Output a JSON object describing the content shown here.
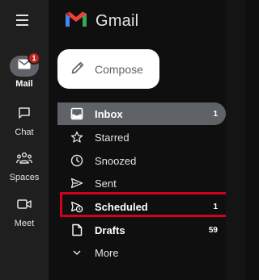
{
  "rail": {
    "items": [
      {
        "label": "Mail",
        "icon": "mail-icon",
        "badge": "1",
        "active": true
      },
      {
        "label": "Chat",
        "icon": "chat-icon"
      },
      {
        "label": "Spaces",
        "icon": "spaces-icon"
      },
      {
        "label": "Meet",
        "icon": "meet-icon"
      }
    ]
  },
  "brand": {
    "name": "Gmail",
    "icon": "gmail-logo"
  },
  "compose": {
    "label": "Compose",
    "icon": "pencil-icon"
  },
  "nav": {
    "items": [
      {
        "label": "Inbox",
        "count": "1",
        "icon": "inbox-icon",
        "active": true
      },
      {
        "label": "Starred",
        "count": "",
        "icon": "star-icon"
      },
      {
        "label": "Snoozed",
        "count": "",
        "icon": "clock-icon"
      },
      {
        "label": "Sent",
        "count": "",
        "icon": "send-icon"
      },
      {
        "label": "Scheduled",
        "count": "1",
        "icon": "scheduled-send-icon"
      },
      {
        "label": "Drafts",
        "count": "59",
        "icon": "draft-icon"
      },
      {
        "label": "More",
        "count": "",
        "icon": "chevron-down-icon"
      }
    ]
  },
  "colors": {
    "rail_bg": "#1f1f1f",
    "panel_bg": "#0f0f0f",
    "active_bg": "#5f6368",
    "badge": "#c5221f",
    "highlight": "#d0021b"
  }
}
